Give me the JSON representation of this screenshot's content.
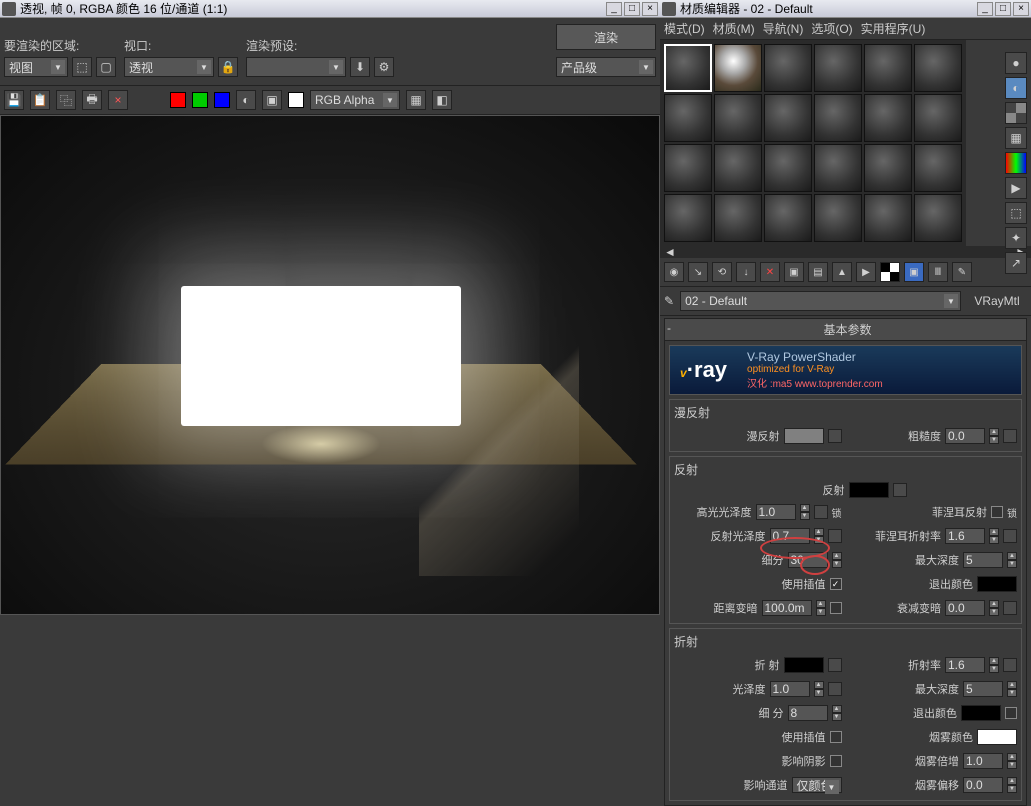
{
  "left": {
    "title": "透视, 帧 0, RGBA 颜色 16 位/通道 (1:1)",
    "render_area_label": "要渲染的区域:",
    "render_area_value": "视图",
    "viewport_label": "视口:",
    "viewport_value": "透视",
    "preset_label": "渲染预设:",
    "preset_value": "",
    "output_value": "产品级",
    "render_btn": "渲染",
    "channel_value": "RGB Alpha"
  },
  "right": {
    "title": "材质编辑器 - 02 - Default",
    "menu": [
      "模式(D)",
      "材质(M)",
      "导航(N)",
      "选项(O)",
      "实用程序(U)"
    ],
    "material_name": "02 - Default",
    "material_type": "VRayMtl",
    "rollout_title": "基本参数",
    "banner": {
      "brand": "v·ray",
      "title": "V-Ray PowerShader",
      "sub": "optimized for V-Ray",
      "credit": "汉化 :ma5 www.toprender.com"
    }
  },
  "sections": {
    "diffuse": {
      "title": "漫反射",
      "diffuse_label": "漫反射",
      "diffuse_color": "#808080",
      "roughness_label": "粗糙度",
      "roughness_value": "0.0"
    },
    "reflect": {
      "title": "反射",
      "reflect_label": "反射",
      "reflect_color": "#000000",
      "hilight_label": "高光光泽度",
      "hilight_value": "1.0",
      "lock_label": "锁",
      "refl_gloss_label": "反射光泽度",
      "refl_gloss_value": "0.7",
      "fresnel_label": "菲涅耳反射",
      "fresnel_lock": "锁",
      "fresnel_ior_label": "菲涅耳折射率",
      "fresnel_ior_value": "1.6",
      "subdiv_label": "细分",
      "subdiv_value": "30",
      "max_depth_label": "最大深度",
      "max_depth_value": "5",
      "use_interp_label": "使用插值",
      "use_interp_checked": true,
      "exit_color_label": "退出颜色",
      "exit_color": "#000000",
      "dim_dist_label": "距离变暗",
      "dim_dist_value": "100.0m",
      "dim_falloff_label": "衰减变暗",
      "dim_falloff_value": "0.0"
    },
    "refract": {
      "title": "折射",
      "refract_label": "折 射",
      "refract_color": "#000000",
      "ior_label": "折射率",
      "ior_value": "1.6",
      "gloss_label": "光泽度",
      "gloss_value": "1.0",
      "max_depth_label": "最大深度",
      "max_depth_value": "5",
      "subdiv_label": "细 分",
      "subdiv_value": "8",
      "exit_color_label": "退出颜色",
      "exit_color": "#000000",
      "use_interp_label": "使用插值",
      "fog_color_label": "烟雾颜色",
      "fog_color": "#ffffff",
      "affect_shadow_label": "影响阴影",
      "fog_mult_label": "烟雾倍增",
      "fog_mult_value": "1.0",
      "affect_channel_label": "影响通道",
      "affect_channel_value": "仅颜色",
      "fog_bias_label": "烟雾偏移",
      "fog_bias_value": "0.0"
    }
  }
}
